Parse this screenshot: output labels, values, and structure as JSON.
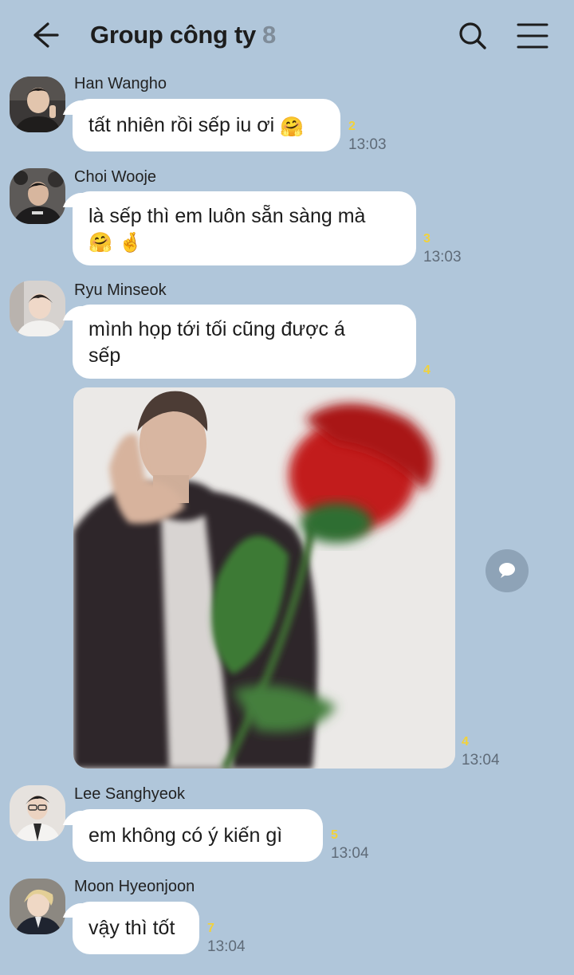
{
  "header": {
    "title": "Group công ty",
    "member_count": "8",
    "back_icon": "arrow-left-icon",
    "search_icon": "search-icon",
    "menu_icon": "hamburger-menu-icon"
  },
  "messages": [
    {
      "sender": "Han Wangho",
      "text_lines": [
        "tất nhiên rồi sếp iu ơi"
      ],
      "emojis": "🤗",
      "unread": "2",
      "time": "13:03"
    },
    {
      "sender": "Choi Wooje",
      "text_lines": [
        "là sếp thì em luôn sẵn sàng mà"
      ],
      "emojis": "🤗 🤞",
      "unread": "3",
      "time": "13:03"
    },
    {
      "sender": "Ryu Minseok",
      "text_lines": [
        "mình họp tới tối cũng được á",
        "sếp"
      ],
      "unread": "4"
    },
    {
      "type": "image",
      "image_icon": "photo-man-holding-rose",
      "unread": "4",
      "time": "13:04"
    },
    {
      "sender": "Lee Sanghyeok",
      "text_lines": [
        "em không có ý kiến gì"
      ],
      "unread": "5",
      "time": "13:04"
    },
    {
      "sender": "Moon Hyeonjoon",
      "text_lines": [
        "vậy thì tốt"
      ],
      "unread": "7",
      "time": "13:04"
    }
  ],
  "reply_icon": "chat-bubble-icon",
  "colors": {
    "background": "#b0c6da",
    "bubble": "#ffffff",
    "unread": "#f2d23a",
    "time": "#5f6b78"
  }
}
